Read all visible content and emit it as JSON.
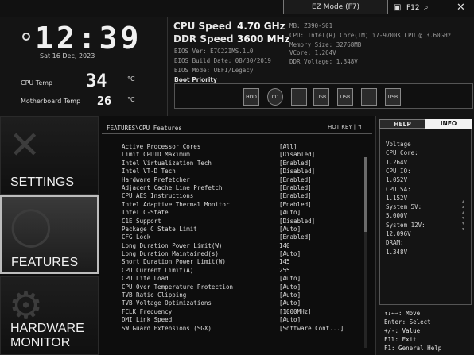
{
  "topbar": {
    "mode_label": "EZ Mode (F7)",
    "f12_label": "F12"
  },
  "clock": {
    "time": "12:39",
    "date": "Sat  16 Dec, 2023"
  },
  "temps": {
    "cpu_label": "CPU Temp",
    "cpu_value": "34",
    "mb_label": "Motherboard Temp",
    "mb_value": "26",
    "unit": "°C"
  },
  "system": {
    "cpu_speed_label": "CPU Speed",
    "cpu_speed_value": "4.70 GHz",
    "ddr_speed_label": "DDR Speed",
    "ddr_speed_value": "3600 MHz",
    "bios_ver": "BIOS Ver: E7C22IMS.1L0",
    "bios_build": "BIOS Build Date: 08/30/2019",
    "bios_mode": "BIOS Mode: UEFI/Legacy",
    "mb": "MB: Z390-S01",
    "cpu": "CPU: Intel(R) Core(TM) i7-9700K CPU @ 3.60GHz",
    "memory": "Memory Size: 32768MB",
    "vcore": "VCore: 1.264V",
    "ddr_voltage": "DDR Voltage: 1.348V",
    "boot_priority_label": "Boot Priority",
    "boot_devices": [
      "HDD",
      "CD",
      "",
      "USB",
      "USB",
      "",
      "USB"
    ]
  },
  "nav": {
    "settings": "SETTINGS",
    "features": "FEATURES",
    "hardware_monitor_line1": "HARDWARE",
    "hardware_monitor_line2": "MONITOR"
  },
  "main": {
    "breadcrumb": "FEATURES\\CPU Features",
    "hotkey": "HOT KEY  |  ↰",
    "rows": [
      {
        "name": "Active Processor Cores",
        "value": "[All]"
      },
      {
        "name": "Limit CPUID Maximum",
        "value": "[Disabled]"
      },
      {
        "name": "Intel Virtualization Tech",
        "value": "[Enabled]"
      },
      {
        "name": "Intel VT-D Tech",
        "value": "[Disabled]"
      },
      {
        "name": "Hardware Prefetcher",
        "value": "[Enabled]"
      },
      {
        "name": "Adjacent Cache Line Prefetch",
        "value": "[Enabled]"
      },
      {
        "name": "CPU AES Instructions",
        "value": "[Enabled]"
      },
      {
        "name": "Intel Adaptive Thermal Monitor",
        "value": "[Enabled]"
      },
      {
        "name": "Intel C-State",
        "value": "[Auto]"
      },
      {
        "name": "C1E Support",
        "value": "[Disabled]"
      },
      {
        "name": "Package C State Limit",
        "value": "[Auto]"
      },
      {
        "name": "CFG Lock",
        "value": "[Enabled]"
      },
      {
        "name": "Long Duration Power Limit(W)",
        "value": "140"
      },
      {
        "name": "Long Duration Maintained(s)",
        "value": "[Auto]"
      },
      {
        "name": "Short Duration Power Limit(W)",
        "value": "145"
      },
      {
        "name": "CPU Current Limit(A)",
        "value": "255"
      },
      {
        "name": "CPU Lite Load",
        "value": "[Auto]"
      },
      {
        "name": "CPU Over Temperature Protection",
        "value": "[Auto]"
      },
      {
        "name": "TVB Ratio Clipping",
        "value": "[Auto]"
      },
      {
        "name": "TVB Voltage Optimizations",
        "value": "[Auto]"
      },
      {
        "name": "FCLK Frequency",
        "value": "[1000MHz]"
      },
      {
        "name": "DMI Link Speed",
        "value": "[Auto]"
      },
      {
        "name": "SW Guard Extensions (SGX)",
        "value": "[Software Cont...]"
      }
    ]
  },
  "help": {
    "help_tab": "HELP",
    "info_tab": "INFO",
    "info_lines": [
      "Voltage",
      "CPU Core:",
      "     1.264V",
      "CPU IO:",
      "     1.052V",
      "CPU SA:",
      "     1.152V",
      "System 5V:",
      "     5.000V",
      "System 12V:",
      "    12.096V",
      "DRAM:",
      "     1.348V"
    ],
    "keys": [
      "↑↓←→: Move",
      "Enter: Select",
      "+/-: Value",
      "F1l: Exit",
      "F1: General Help"
    ]
  }
}
